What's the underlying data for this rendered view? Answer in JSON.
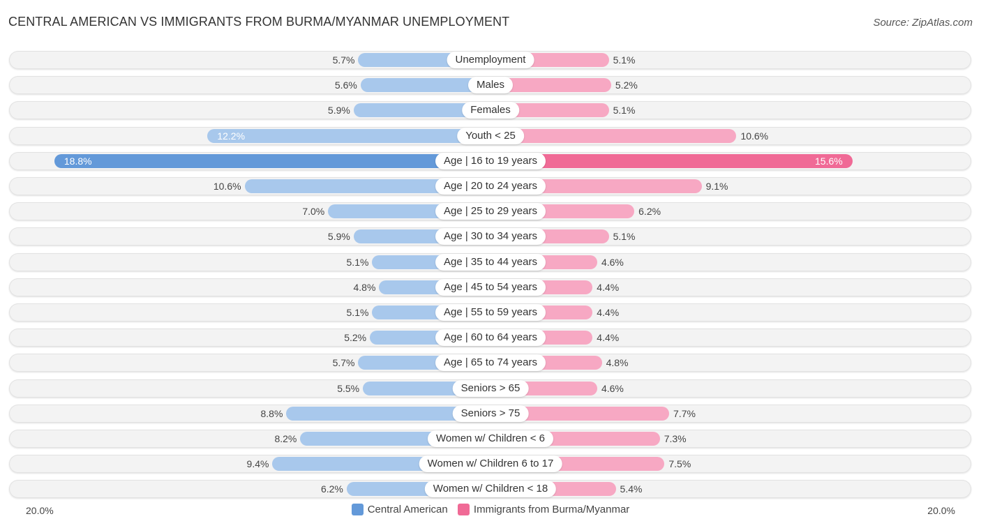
{
  "title": "CENTRAL AMERICAN VS IMMIGRANTS FROM BURMA/MYANMAR UNEMPLOYMENT",
  "source": "Source: ZipAtlas.com",
  "colors": {
    "left_light": "#a8c8ec",
    "left_strong": "#6399d9",
    "right_light": "#f7a8c3",
    "right_strong": "#f06a96"
  },
  "chart_data": {
    "type": "bar",
    "orientation": "horizontal-diverging",
    "title": "CENTRAL AMERICAN VS IMMIGRANTS FROM BURMA/MYANMAR UNEMPLOYMENT",
    "xlim": [
      -20,
      20
    ],
    "axis_labels": {
      "left": "20.0%",
      "right": "20.0%"
    },
    "legend": {
      "placement": "bottom-center",
      "entries": [
        "Central American",
        "Immigrants from Burma/Myanmar"
      ]
    },
    "categories": [
      "Unemployment",
      "Males",
      "Females",
      "Youth < 25",
      "Age | 16 to 19 years",
      "Age | 20 to 24 years",
      "Age | 25 to 29 years",
      "Age | 30 to 34 years",
      "Age | 35 to 44 years",
      "Age | 45 to 54 years",
      "Age | 55 to 59 years",
      "Age | 60 to 64 years",
      "Age | 65 to 74 years",
      "Seniors > 65",
      "Seniors > 75",
      "Women w/ Children < 6",
      "Women w/ Children 6 to 17",
      "Women w/ Children < 18"
    ],
    "series": [
      {
        "name": "Central American",
        "side": "left",
        "values": [
          5.7,
          5.6,
          5.9,
          12.2,
          18.8,
          10.6,
          7.0,
          5.9,
          5.1,
          4.8,
          5.1,
          5.2,
          5.7,
          5.5,
          8.8,
          8.2,
          9.4,
          6.2
        ],
        "labels": [
          "5.7%",
          "5.6%",
          "5.9%",
          "12.2%",
          "18.8%",
          "10.6%",
          "7.0%",
          "5.9%",
          "5.1%",
          "4.8%",
          "5.1%",
          "5.2%",
          "5.7%",
          "5.5%",
          "8.8%",
          "8.2%",
          "9.4%",
          "6.2%"
        ]
      },
      {
        "name": "Immigrants from Burma/Myanmar",
        "side": "right",
        "values": [
          5.1,
          5.2,
          5.1,
          10.6,
          15.6,
          9.1,
          6.2,
          5.1,
          4.6,
          4.4,
          4.4,
          4.4,
          4.8,
          4.6,
          7.7,
          7.3,
          7.5,
          5.4
        ],
        "labels": [
          "5.1%",
          "5.2%",
          "5.1%",
          "10.6%",
          "15.6%",
          "9.1%",
          "6.2%",
          "5.1%",
          "4.6%",
          "4.4%",
          "4.4%",
          "4.4%",
          "4.8%",
          "4.6%",
          "7.7%",
          "7.3%",
          "7.5%",
          "5.4%"
        ]
      }
    ]
  }
}
